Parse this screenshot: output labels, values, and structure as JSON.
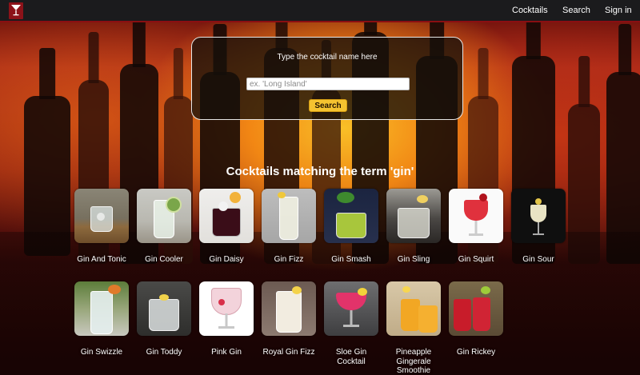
{
  "header": {
    "nav": [
      "Cocktails",
      "Search",
      "Sign in"
    ]
  },
  "search": {
    "label": "Type the cocktail name here",
    "placeholder": "ex. 'Long Island'",
    "value": "",
    "button_label": "Search"
  },
  "results": {
    "heading": "Cocktails matching the term 'gin'",
    "cocktails": [
      {
        "name": "Gin And Tonic",
        "photo": "tumbler-ice-wooden-table"
      },
      {
        "name": "Gin Cooler",
        "photo": "highball-cucumber-lime"
      },
      {
        "name": "Gin Daisy",
        "photo": "rocks-glass-red-berries"
      },
      {
        "name": "Gin Fizz",
        "photo": "collins-glass-lemon"
      },
      {
        "name": "Gin Smash",
        "photo": "green-drink-mint"
      },
      {
        "name": "Gin Sling",
        "photo": "rocks-glass-ice"
      },
      {
        "name": "Gin Squirt",
        "photo": "red-drink-goblet"
      },
      {
        "name": "Gin Sour",
        "photo": "cocktail-glass-dark"
      },
      {
        "name": "Gin Swizzle",
        "photo": "highball-orange-straw"
      },
      {
        "name": "Gin Toddy",
        "photo": "tumbler-lemon-straw"
      },
      {
        "name": "Pink Gin",
        "photo": "balloon-glass-pink"
      },
      {
        "name": "Royal Gin Fizz",
        "photo": "creamy-fizz-lemon"
      },
      {
        "name": "Sloe Gin Cocktail",
        "photo": "pink-coupe-grey"
      },
      {
        "name": "Pineapple Gingerale Smoothie",
        "photo": "orange-drinks"
      },
      {
        "name": "Gin Rickey",
        "photo": "red-highballs-lime"
      }
    ]
  },
  "colors": {
    "header_bg": "#1b1b1d",
    "header_border": "#8a0e12",
    "logo_bg": "#8c1219",
    "button_bg": "#f5c330"
  }
}
